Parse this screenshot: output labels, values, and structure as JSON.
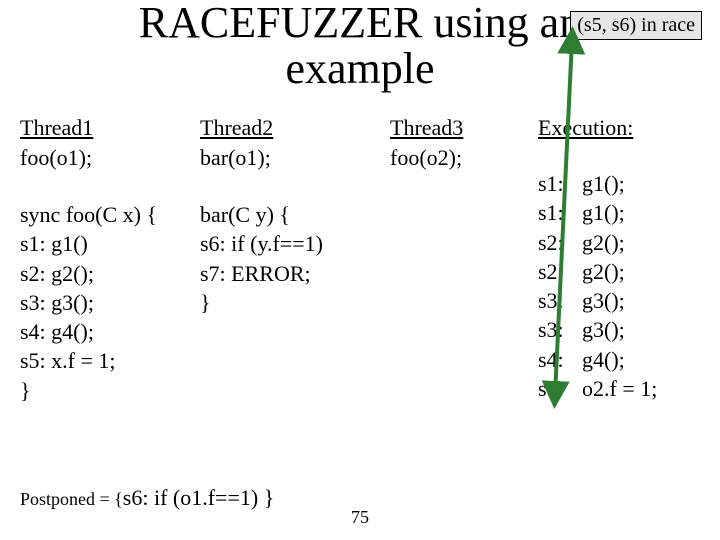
{
  "title_line1": "RACEFUZZER using an",
  "title_line2": "example",
  "badge": "(s5, s6) in race",
  "thread1": {
    "head": "Thread1",
    "call": "foo(o1);"
  },
  "thread2": {
    "head": "Thread2",
    "call": "bar(o1);"
  },
  "thread3": {
    "head": "Thread3",
    "call": "foo(o2);"
  },
  "foo_def": {
    "sig": "sync foo(C x) {",
    "lines": [
      "  s1: g1()",
      "  s2: g2();",
      "  s3: g3();",
      "  s4: g4();",
      "  s5: x.f = 1;"
    ],
    "close": "}"
  },
  "bar_def": {
    "sig": "bar(C y) {",
    "lines": [
      "  s6: if (y.f==1)",
      "  s7:   ERROR;"
    ],
    "close": "}"
  },
  "execution": {
    "head": "Execution:",
    "rows": [
      {
        "lbl": "s1:",
        "val": "g1();"
      },
      {
        "lbl": "s1:",
        "val": "g1();"
      },
      {
        "lbl": "s2:",
        "val": "g2();"
      },
      {
        "lbl": "s2:",
        "val": "g2();"
      },
      {
        "lbl": "s3:",
        "val": "g3();"
      },
      {
        "lbl": "s3:",
        "val": "g3();"
      },
      {
        "lbl": "s4:",
        "val": "g4();"
      },
      {
        "lbl": "s5:",
        "val": "o2.f = 1;"
      }
    ]
  },
  "postponed": {
    "prefix": "Postponed = {",
    "content": "s6: if (o1.f==1)",
    "suffix": " }"
  },
  "pagenum": "75",
  "arrow": {
    "color": "#2e7d32"
  }
}
